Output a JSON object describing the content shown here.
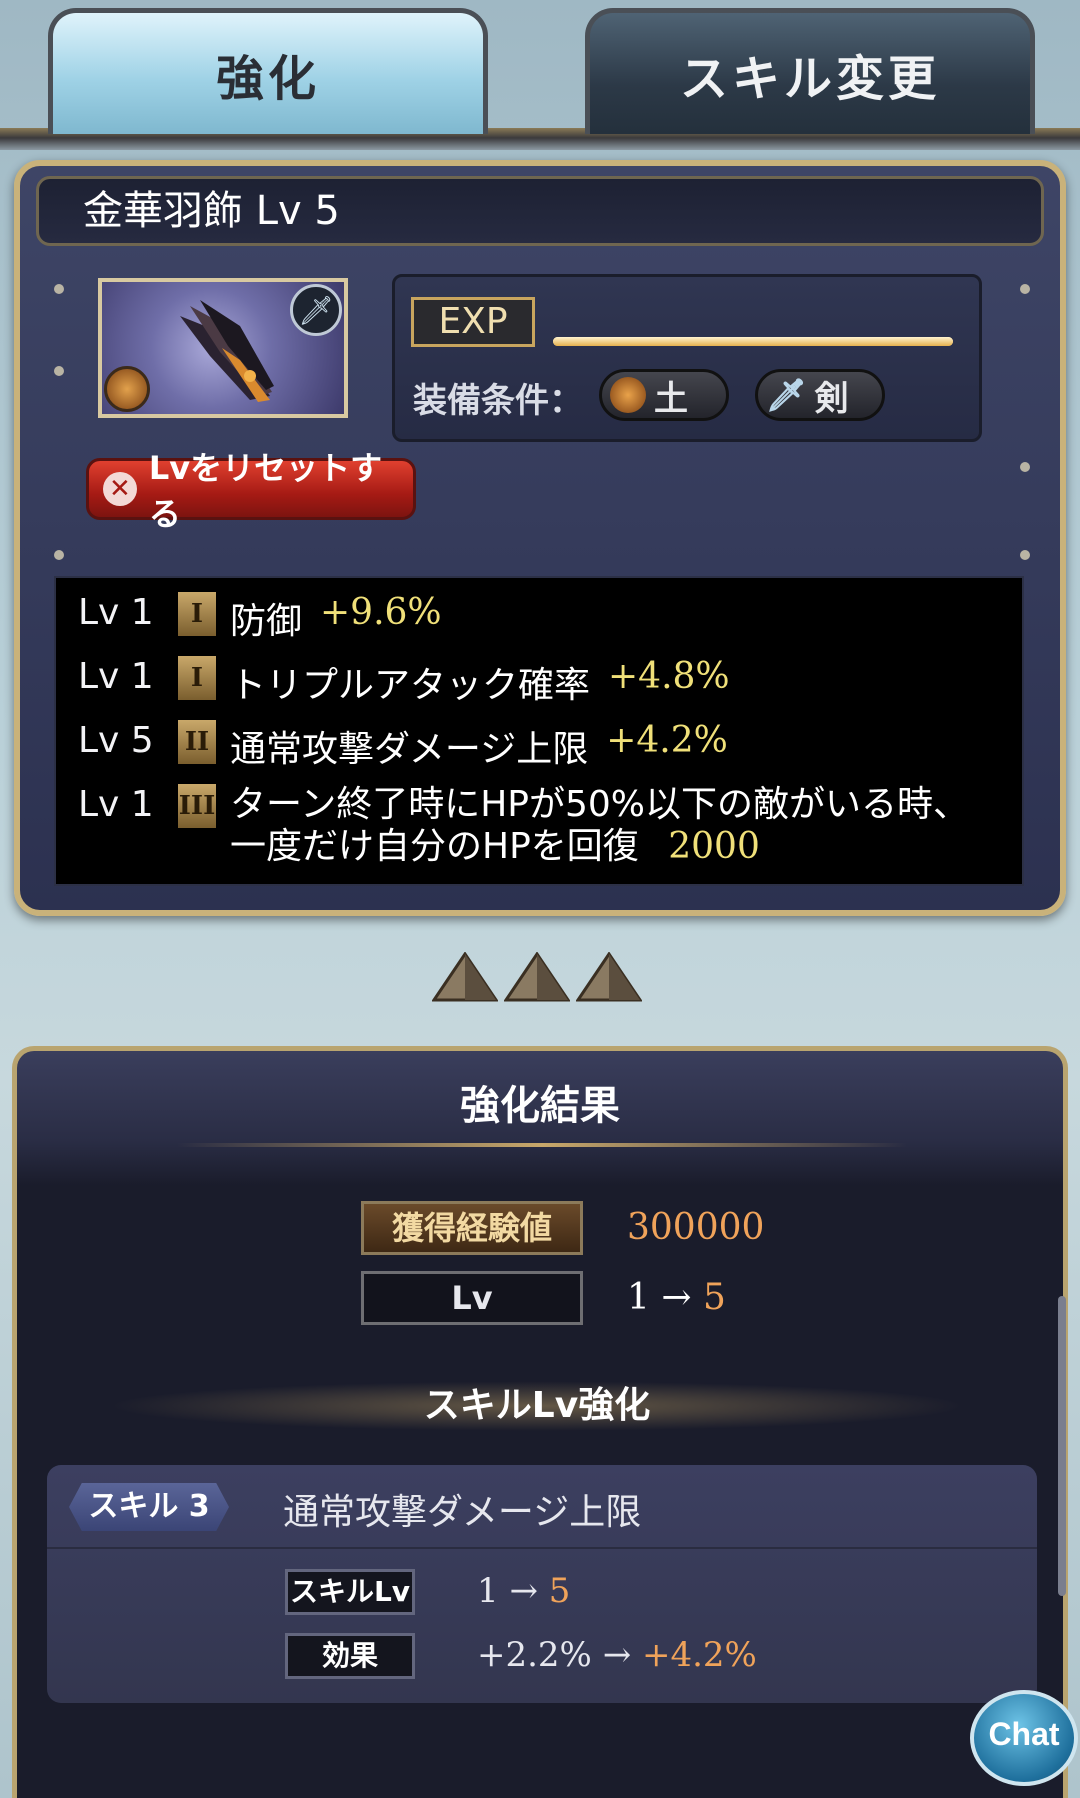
{
  "tabs": [
    {
      "label": "強化",
      "active": true
    },
    {
      "label": "スキル変更",
      "active": false
    }
  ],
  "item": {
    "title": "金華羽飾 Lv 5",
    "exp_label": "EXP",
    "exp_progress": 1.0,
    "equip_label": "装備条件：",
    "equip_element": "土",
    "equip_weapon": "剣",
    "reset_button": "Lvをリセットする"
  },
  "skills": [
    {
      "lv": "Lv 1",
      "tier": "I",
      "name": "防御",
      "value": "+9.6%"
    },
    {
      "lv": "Lv 1",
      "tier": "I",
      "name": "トリプルアタック確率",
      "value": "+4.8%"
    },
    {
      "lv": "Lv 5",
      "tier": "II",
      "name": "通常攻撃ダメージ上限",
      "value": "+4.2%"
    },
    {
      "lv": "Lv 1",
      "tier": "III",
      "name_line1": "ターン終了時にHPが50%以下の敵がいる時、",
      "name_line2": "一度だけ自分のHPを回復",
      "value": "2000"
    }
  ],
  "result": {
    "title": "強化結果",
    "exp_label": "獲得経験値",
    "exp_value": "300000",
    "lv_label": "Lv",
    "lv_from": "1",
    "lv_arrow": "→",
    "lv_to": "5",
    "skill_lv_heading": "スキルLv強化",
    "skill_tag": "スキル 3",
    "skill_name": "通常攻撃ダメージ上限",
    "skill_lv_label": "スキルLv",
    "skill_lv_from": "1",
    "skill_lv_to": "5",
    "effect_label": "効果",
    "effect_from": "+2.2%",
    "effect_to": "+4.2%"
  },
  "chat_button": "Chat",
  "colors": {
    "accent_gold": "#c9a86a",
    "value_yellow": "#f0e079",
    "value_orange": "#f0a35a",
    "reset_red": "#c0281c"
  },
  "icons": [
    "sword-icon",
    "earth-element-icon",
    "close-icon",
    "pyramid-icon",
    "chat-icon"
  ]
}
